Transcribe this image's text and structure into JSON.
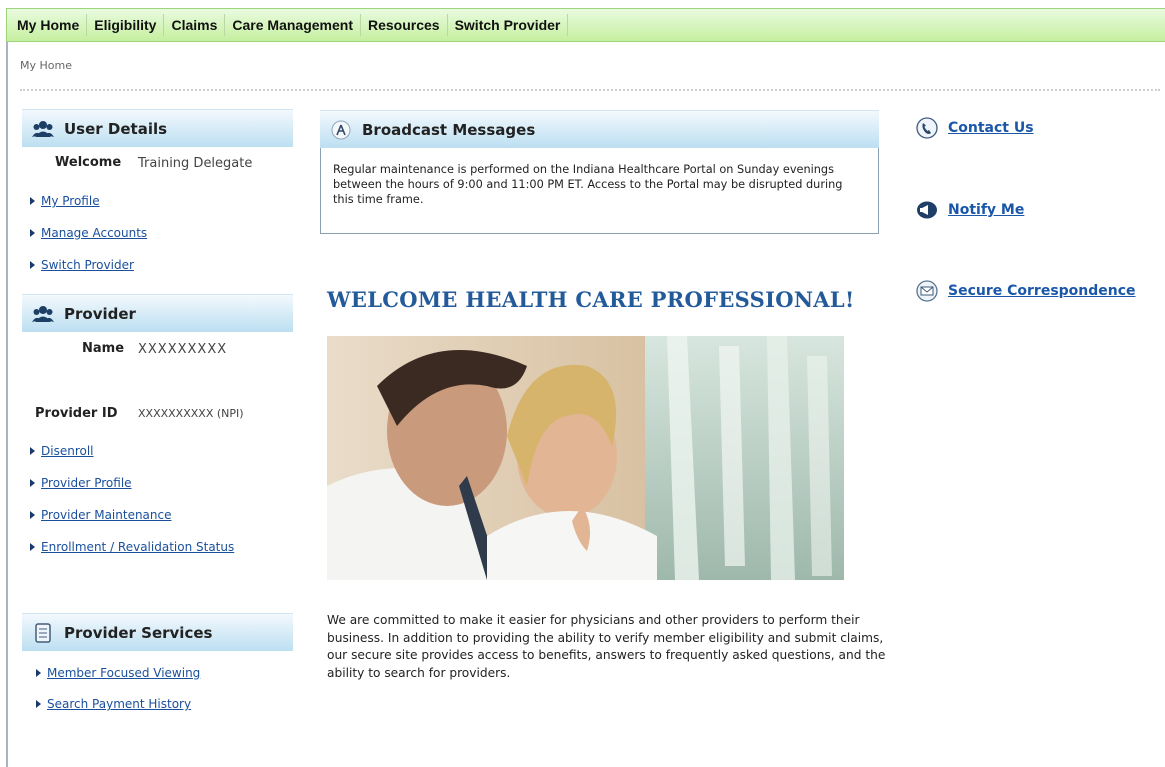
{
  "nav": {
    "items": [
      "My Home",
      "Eligibility",
      "Claims",
      "Care Management",
      "Resources",
      "Switch Provider"
    ]
  },
  "breadcrumb": "My Home",
  "user_details": {
    "title": "User Details",
    "welcome_label": "Welcome",
    "welcome_name": "Training Delegate",
    "links": [
      "My Profile",
      "Manage Accounts",
      "Switch Provider"
    ]
  },
  "provider": {
    "title": "Provider",
    "name_label": "Name",
    "name_value": "XXXXXXXXX",
    "id_label": "Provider ID",
    "id_value": "XXXXXXXXXX (NPI)",
    "links": [
      "Disenroll",
      "Provider Profile",
      "Provider Maintenance",
      "Enrollment / Revalidation Status"
    ]
  },
  "provider_services": {
    "title": "Provider Services",
    "links": [
      "Member Focused Viewing",
      "Search Payment History"
    ]
  },
  "broadcast": {
    "title": "Broadcast Messages",
    "message": "Regular maintenance is performed on the Indiana Healthcare Portal on Sunday evenings between the hours of 9:00 and 11:00 PM ET. Access to the Portal may be disrupted during this time frame."
  },
  "welcome": {
    "heading": "WELCOME HEALTH CARE PROFESSIONAL!",
    "intro": "We are committed to make it easier for physicians and other providers to perform their business. In addition to providing the ability to verify member eligibility and submit claims, our secure site provides access to benefits, answers to frequently asked questions, and the ability to search for providers."
  },
  "right_links": {
    "contact": "Contact Us",
    "notify": "Notify Me",
    "secure": "Secure Correspondence"
  },
  "colors": {
    "nav_green": "#c5ef9f",
    "panel_blue": "#bcdff2",
    "link_blue": "#1a57a8",
    "heading_blue": "#235a99"
  }
}
